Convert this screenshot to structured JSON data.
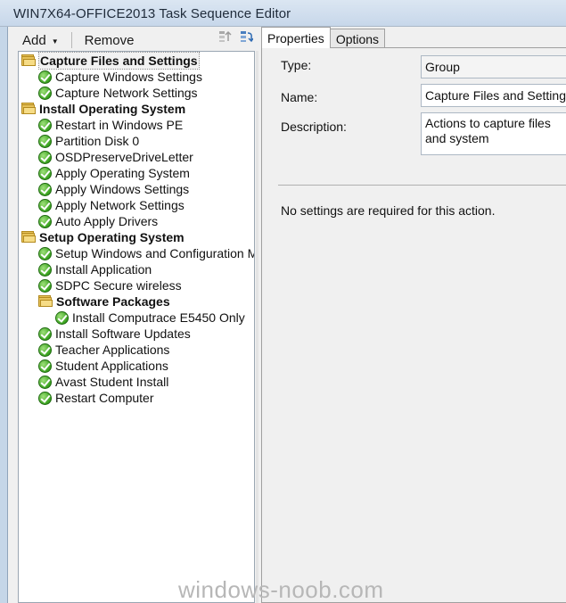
{
  "window": {
    "title": "WIN7X64-OFFICE2013 Task Sequence Editor"
  },
  "toolbar": {
    "add_label": "Add",
    "remove_label": "Remove"
  },
  "tree": {
    "items": [
      {
        "label": "Capture Files and Settings",
        "type": "group"
      },
      {
        "label": "Capture Windows Settings",
        "type": "step"
      },
      {
        "label": "Capture Network Settings",
        "type": "step"
      },
      {
        "label": "Install Operating System",
        "type": "group"
      },
      {
        "label": "Restart in Windows PE",
        "type": "step"
      },
      {
        "label": "Partition Disk 0",
        "type": "step"
      },
      {
        "label": "OSDPreserveDriveLetter",
        "type": "step"
      },
      {
        "label": "Apply Operating System",
        "type": "step"
      },
      {
        "label": "Apply Windows Settings",
        "type": "step"
      },
      {
        "label": "Apply Network Settings",
        "type": "step"
      },
      {
        "label": "Auto Apply Drivers",
        "type": "step"
      },
      {
        "label": "Setup Operating System",
        "type": "group"
      },
      {
        "label": "Setup Windows and Configuration Ma",
        "type": "step"
      },
      {
        "label": "Install Application",
        "type": "step"
      },
      {
        "label": "SDPC Secure wireless",
        "type": "step"
      },
      {
        "label": "Software Packages",
        "type": "group"
      },
      {
        "label": "Install Computrace E5450 Only",
        "type": "step"
      },
      {
        "label": "Install Software Updates",
        "type": "step"
      },
      {
        "label": "Teacher Applications",
        "type": "step"
      },
      {
        "label": "Student Applications",
        "type": "step"
      },
      {
        "label": "Avast Student Install",
        "type": "step"
      },
      {
        "label": "Restart Computer",
        "type": "step"
      }
    ]
  },
  "tabs": [
    {
      "label": "Properties"
    },
    {
      "label": "Options"
    }
  ],
  "properties": {
    "type_label": "Type:",
    "type_value": "Group",
    "name_label": "Name:",
    "name_value": "Capture Files and Settings",
    "description_label": "Description:",
    "description_value": "Actions to capture files and system",
    "note": "No settings are required  for this action."
  },
  "watermark": "windows-noob.com"
}
